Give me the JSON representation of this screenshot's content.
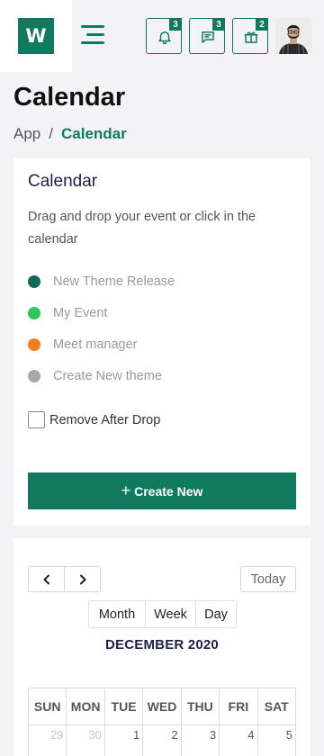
{
  "header": {
    "logo_letter": "W",
    "notifications": [
      {
        "icon": "bell-icon",
        "count": "3"
      },
      {
        "icon": "message-icon",
        "count": "3"
      },
      {
        "icon": "gift-icon",
        "count": "2"
      }
    ],
    "accent_color": "#0f7a5e"
  },
  "page": {
    "title": "Calendar",
    "breadcrumb": {
      "root": "App",
      "separator": "/",
      "current": "Calendar"
    }
  },
  "events_card": {
    "title": "Calendar",
    "description": "Drag and drop your event or click in the calendar",
    "events": [
      {
        "label": "New Theme Release",
        "color": "#0f6b56"
      },
      {
        "label": "My Event",
        "color": "#2ec55a"
      },
      {
        "label": "Meet manager",
        "color": "#f47b20"
      },
      {
        "label": "Create New theme",
        "color": "#a9a9a9"
      }
    ],
    "remove_after_drop_label": "Remove After Drop",
    "remove_after_drop_checked": false,
    "create_button_label": "Create New"
  },
  "calendar": {
    "prev_icon": "chevron-left-icon",
    "next_icon": "chevron-right-icon",
    "today_label": "Today",
    "views": [
      "Month",
      "Week",
      "Day"
    ],
    "month_title": "DECEMBER 2020",
    "weekdays": [
      "SUN",
      "MON",
      "TUE",
      "WED",
      "THU",
      "FRI",
      "SAT"
    ],
    "first_week": [
      {
        "day": "29",
        "muted": true
      },
      {
        "day": "30",
        "muted": true
      },
      {
        "day": "1",
        "muted": false
      },
      {
        "day": "2",
        "muted": false
      },
      {
        "day": "3",
        "muted": false
      },
      {
        "day": "4",
        "muted": false
      },
      {
        "day": "5",
        "muted": false
      }
    ]
  }
}
